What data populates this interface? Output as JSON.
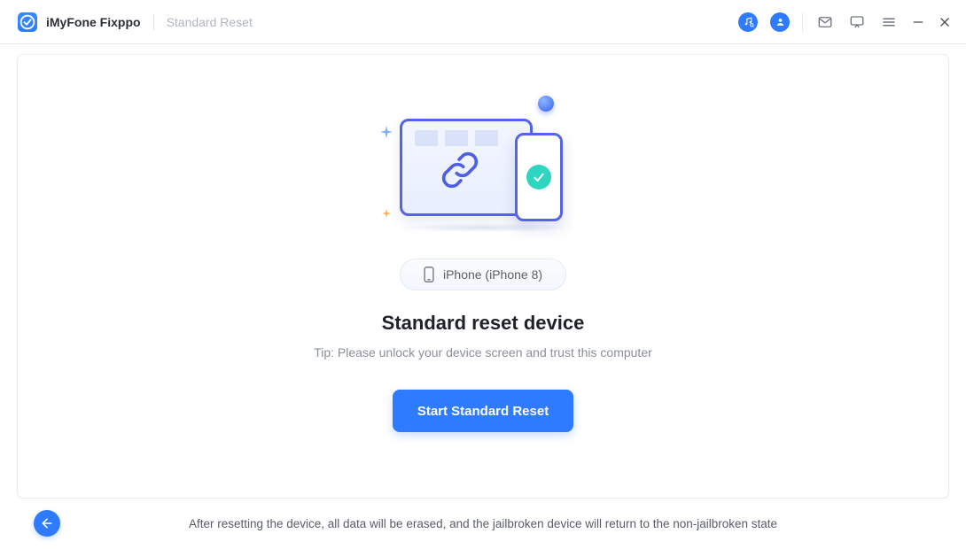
{
  "titlebar": {
    "app_name": "iMyFone Fixppo",
    "subtitle": "Standard Reset"
  },
  "device": {
    "label": "iPhone (iPhone 8)"
  },
  "main": {
    "headline": "Standard reset device",
    "tip": "Tip: Please unlock your device screen and trust this computer",
    "cta_label": "Start Standard Reset"
  },
  "footer": {
    "note": "After resetting the device, all data will be erased, and the jailbroken device will return to the non-jailbroken state"
  }
}
